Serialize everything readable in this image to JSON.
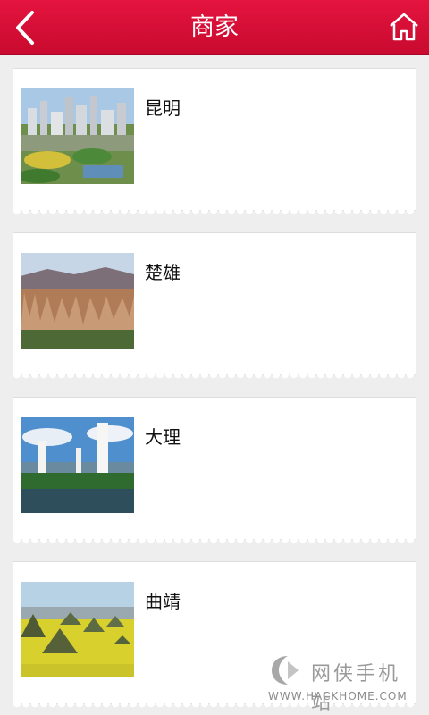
{
  "header": {
    "title": "商家",
    "back_icon": "chevron-left-icon",
    "home_icon": "home-icon"
  },
  "merchants": [
    {
      "name": "昆明",
      "image": "kunming-city-photo"
    },
    {
      "name": "楚雄",
      "image": "chuxiong-landscape-photo"
    },
    {
      "name": "大理",
      "image": "dali-pagodas-photo"
    },
    {
      "name": "曲靖",
      "image": "qujing-fields-photo"
    }
  ],
  "watermark": {
    "text": "网侠手机站",
    "url": "WWW.HACKHOME.COM"
  },
  "colors": {
    "header_bg": "#d50f37",
    "page_bg": "#eeeeee",
    "card_bg": "#ffffff"
  }
}
